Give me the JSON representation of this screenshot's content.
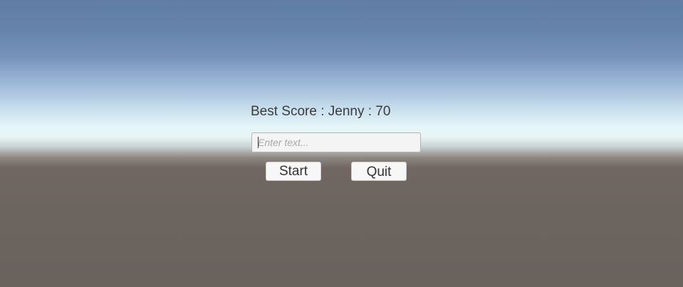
{
  "menu": {
    "best_score_text": "Best Score : Jenny : 70",
    "name_input": {
      "value": "",
      "placeholder": "Enter text..."
    },
    "start_label": "Start",
    "quit_label": "Quit"
  }
}
